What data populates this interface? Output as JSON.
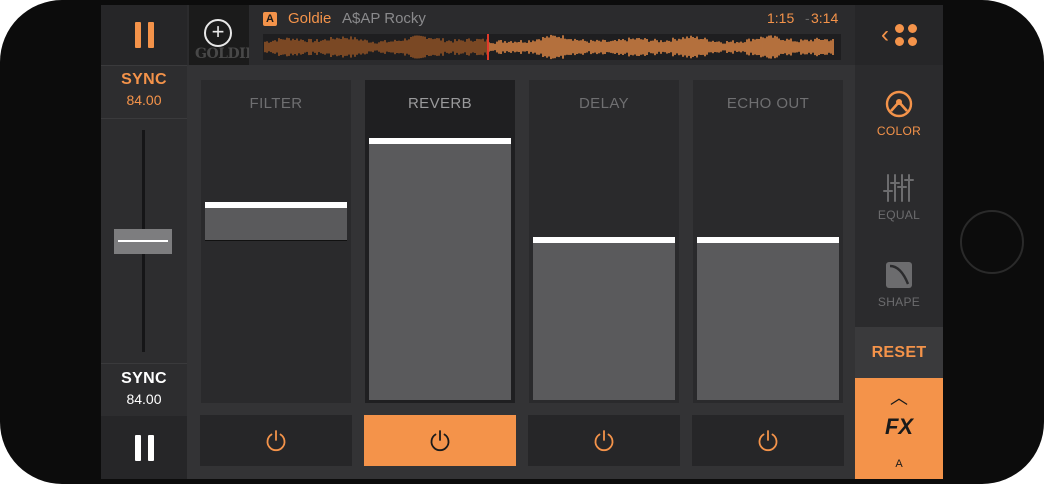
{
  "colors": {
    "accent": "#f4934a",
    "white": "#ffffff",
    "fill": "#5a5a5c",
    "panel": "#2a2a2c",
    "panel_active": "#1f1f21"
  },
  "track": {
    "deck": "A",
    "title": "Goldie",
    "artist": "A$AP Rocky",
    "position": "1:15",
    "separator": "-",
    "duration": "3:14",
    "cover_text": "GOLDIE",
    "playhead_fraction": 0.39
  },
  "left_panel": {
    "sync_top": {
      "label": "SYNC",
      "bpm": "84.00"
    },
    "sync_bottom": {
      "label": "SYNC",
      "bpm": "84.00"
    },
    "pitch_level": 0.5
  },
  "fx": [
    {
      "name": "FILTER",
      "level": 0.62,
      "mode": "bipolar",
      "active": false,
      "on": false
    },
    {
      "name": "REVERB",
      "level": 0.82,
      "mode": "fill",
      "active": true,
      "on": true
    },
    {
      "name": "DELAY",
      "level": 0.51,
      "mode": "fill",
      "active": false,
      "on": false
    },
    {
      "name": "ECHO OUT",
      "level": 0.51,
      "mode": "fill",
      "active": false,
      "on": false
    }
  ],
  "right_panel": {
    "tools": [
      {
        "label": "COLOR",
        "icon": "color-knob-icon",
        "active": true
      },
      {
        "label": "EQUAL",
        "icon": "equalizer-icon",
        "active": false
      },
      {
        "label": "SHAPE",
        "icon": "shape-icon",
        "active": false
      }
    ],
    "reset_label": "RESET",
    "fx_label": "FX",
    "fx_deck": "A",
    "fx_caret": "︿"
  }
}
